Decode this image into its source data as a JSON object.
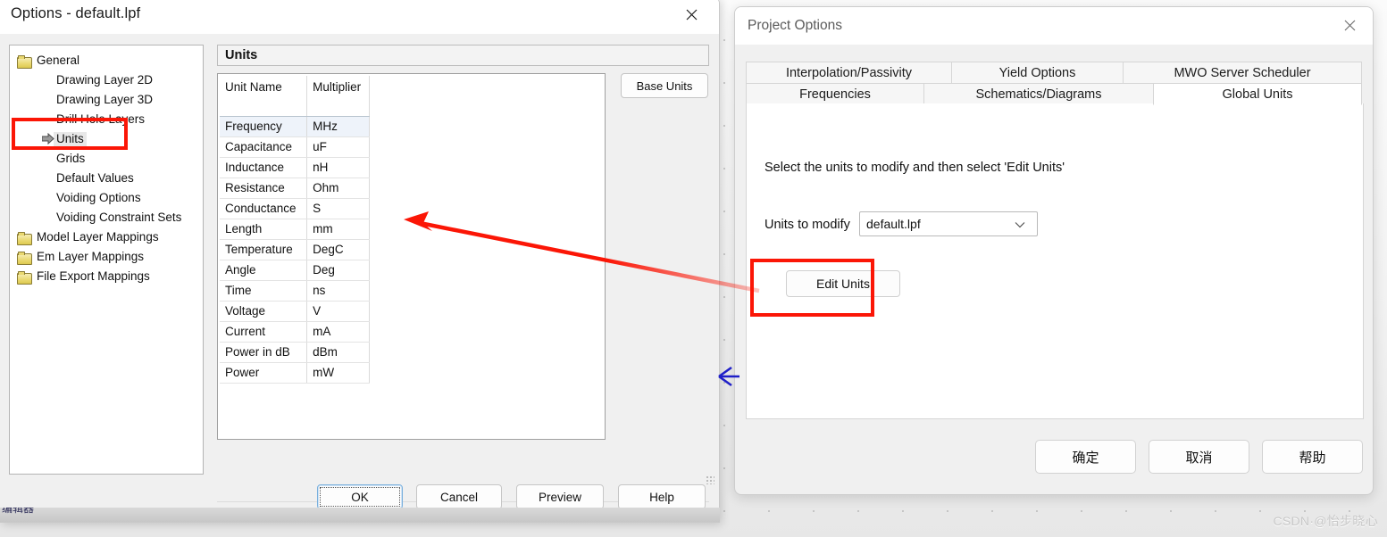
{
  "options_window": {
    "title": "Options - default.lpf",
    "close_icon": "close-icon",
    "tree": [
      {
        "label": "General",
        "level": 0,
        "icon": "folder-icon",
        "selected": false
      },
      {
        "label": "Drawing Layer 2D",
        "level": 1,
        "icon": "",
        "selected": false
      },
      {
        "label": "Drawing Layer 3D",
        "level": 1,
        "icon": "",
        "selected": false
      },
      {
        "label": "Drill Hole Layers",
        "level": 1,
        "icon": "",
        "selected": false
      },
      {
        "label": "Units",
        "level": 1,
        "icon": "arrow-marker-icon",
        "selected": true
      },
      {
        "label": "Grids",
        "level": 1,
        "icon": "",
        "selected": false
      },
      {
        "label": "Default Values",
        "level": 1,
        "icon": "",
        "selected": false
      },
      {
        "label": "Voiding Options",
        "level": 1,
        "icon": "",
        "selected": false
      },
      {
        "label": "Voiding Constraint Sets",
        "level": 1,
        "icon": "",
        "selected": false
      },
      {
        "label": "Model Layer Mappings",
        "level": 0,
        "icon": "folder-icon",
        "selected": false
      },
      {
        "label": "Em Layer Mappings",
        "level": 0,
        "icon": "folder-icon",
        "selected": false
      },
      {
        "label": "File Export Mappings",
        "level": 0,
        "icon": "folder-icon",
        "selected": false
      }
    ],
    "pane_header": "Units",
    "base_units_label": "Base Units",
    "units_table": {
      "columns": [
        "Unit Name",
        "Multiplier"
      ],
      "rows": [
        {
          "name": "Frequency",
          "multiplier": "MHz",
          "selected": true
        },
        {
          "name": "Capacitance",
          "multiplier": "uF",
          "selected": false
        },
        {
          "name": "Inductance",
          "multiplier": "nH",
          "selected": false
        },
        {
          "name": "Resistance",
          "multiplier": "Ohm",
          "selected": false
        },
        {
          "name": "Conductance",
          "multiplier": "S",
          "selected": false
        },
        {
          "name": "Length",
          "multiplier": "mm",
          "selected": false
        },
        {
          "name": "Temperature",
          "multiplier": "DegC",
          "selected": false
        },
        {
          "name": "Angle",
          "multiplier": "Deg",
          "selected": false
        },
        {
          "name": "Time",
          "multiplier": "ns",
          "selected": false
        },
        {
          "name": "Voltage",
          "multiplier": "V",
          "selected": false
        },
        {
          "name": "Current",
          "multiplier": "mA",
          "selected": false
        },
        {
          "name": "Power in dB",
          "multiplier": "dBm",
          "selected": false
        },
        {
          "name": "Power",
          "multiplier": "mW",
          "selected": false
        }
      ]
    },
    "buttons": {
      "ok": "OK",
      "cancel": "Cancel",
      "preview": "Preview",
      "help": "Help"
    }
  },
  "project_window": {
    "title": "Project Options",
    "close_icon": "close-icon",
    "tabs_row1": [
      {
        "label": "Interpolation/Passivity",
        "active": false
      },
      {
        "label": "Yield Options",
        "active": false
      },
      {
        "label": "MWO Server Scheduler",
        "active": false
      }
    ],
    "tabs_row2": [
      {
        "label": "Frequencies",
        "active": false
      },
      {
        "label": "Schematics/Diagrams",
        "active": false
      },
      {
        "label": "Global Units",
        "active": true
      }
    ],
    "panel": {
      "hint": "Select the units to modify and then select 'Edit Units'",
      "units_to_modify_label": "Units to modify",
      "units_to_modify_value": "default.lpf",
      "units_to_modify_options": [
        "default.lpf"
      ],
      "edit_units_label": "Edit Units"
    },
    "buttons": {
      "ok": "确定",
      "cancel": "取消",
      "help": "帮助"
    }
  },
  "annotations": {
    "red_highlight_units": "red-rectangle-around-units-tree-item",
    "red_highlight_edit_units": "red-rectangle-around-edit-units-button",
    "red_arrow": "red-arrow-from-edit-units-to-units-pane",
    "blue_arrow": "blue-left-arrow"
  },
  "watermark": "CSDN·@怡步晓心",
  "taskbar_sliver_text": "编辑器"
}
